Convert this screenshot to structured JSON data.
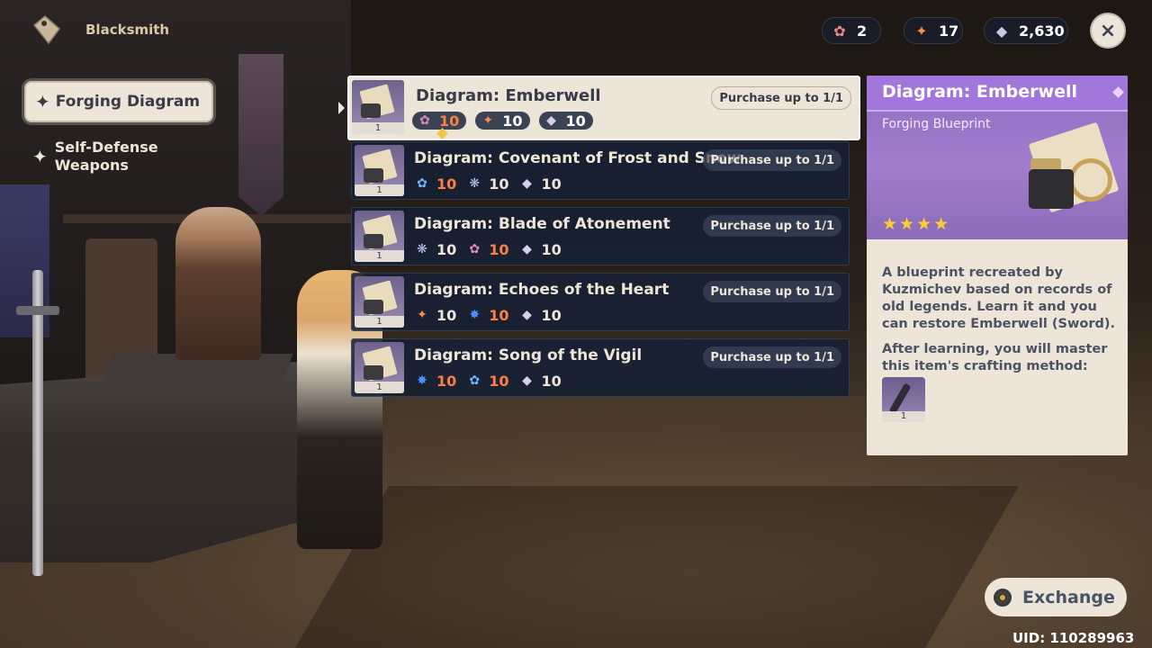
{
  "header": {
    "title": "Blacksmith",
    "currencies": [
      {
        "icon": "dream-solvent-icon",
        "value": "2"
      },
      {
        "icon": "crystal-core-icon",
        "value": "17"
      },
      {
        "icon": "crystal-chunk-icon",
        "value": "2,630"
      }
    ],
    "close_label": "×"
  },
  "nav": {
    "items": [
      {
        "label": "Forging Diagram",
        "active": true
      },
      {
        "label": "Self-Defense Weapons",
        "active": false
      }
    ]
  },
  "list": [
    {
      "title": "Diagram: Emberwell",
      "limit": "Purchase up to 1/1",
      "qty": "1",
      "selected": true,
      "costs": [
        {
          "icon": "purple-flower-icon",
          "value": "10",
          "insufficient": true
        },
        {
          "icon": "orange-bird-icon",
          "value": "10",
          "insufficient": false
        },
        {
          "icon": "crystal-icon",
          "value": "10",
          "insufficient": false
        }
      ]
    },
    {
      "title": "Diagram: Covenant of Frost and Snow",
      "limit": "Purchase up to 1/1",
      "qty": "1",
      "costs": [
        {
          "icon": "blue-flower-icon",
          "value": "10",
          "insufficient": true
        },
        {
          "icon": "blue-moth-icon",
          "value": "10",
          "insufficient": false
        },
        {
          "icon": "crystal-icon",
          "value": "10",
          "insufficient": false
        }
      ]
    },
    {
      "title": "Diagram: Blade of Atonement",
      "limit": "Purchase up to 1/1",
      "qty": "1",
      "costs": [
        {
          "icon": "blue-moth-icon",
          "value": "10",
          "insufficient": false
        },
        {
          "icon": "purple-flower-icon",
          "value": "10",
          "insufficient": true
        },
        {
          "icon": "crystal-icon",
          "value": "10",
          "insufficient": false
        }
      ]
    },
    {
      "title": "Diagram: Echoes of the Heart",
      "limit": "Purchase up to 1/1",
      "qty": "1",
      "costs": [
        {
          "icon": "orange-bird-icon",
          "value": "10",
          "insufficient": false
        },
        {
          "icon": "blue-star-icon",
          "value": "10",
          "insufficient": true
        },
        {
          "icon": "crystal-icon",
          "value": "10",
          "insufficient": false
        }
      ]
    },
    {
      "title": "Diagram: Song of the Vigil",
      "limit": "Purchase up to 1/1",
      "qty": "1",
      "costs": [
        {
          "icon": "blue-star-icon",
          "value": "10",
          "insufficient": true
        },
        {
          "icon": "blue-flower-icon",
          "value": "10",
          "insufficient": true
        },
        {
          "icon": "crystal-icon",
          "value": "10",
          "insufficient": false
        }
      ]
    }
  ],
  "detail": {
    "title": "Diagram: Emberwell",
    "type": "Forging Blueprint",
    "rarity": 4,
    "description": "A blueprint recreated by Kuzmichev based on records of old legends. Learn it and you can restore Emberwell (Sword).",
    "learn_text": "After learning, you will master this item's crafting method:",
    "craft_qty": "1"
  },
  "exchange_label": "Exchange",
  "uid": "UID: 110289963",
  "colors": {
    "panel_bg": "#ece5d8",
    "row_bg": "#16203a",
    "purple_rarity": "#a177dc",
    "insufficient": "#ff7e45",
    "star": "#ffcc32"
  }
}
